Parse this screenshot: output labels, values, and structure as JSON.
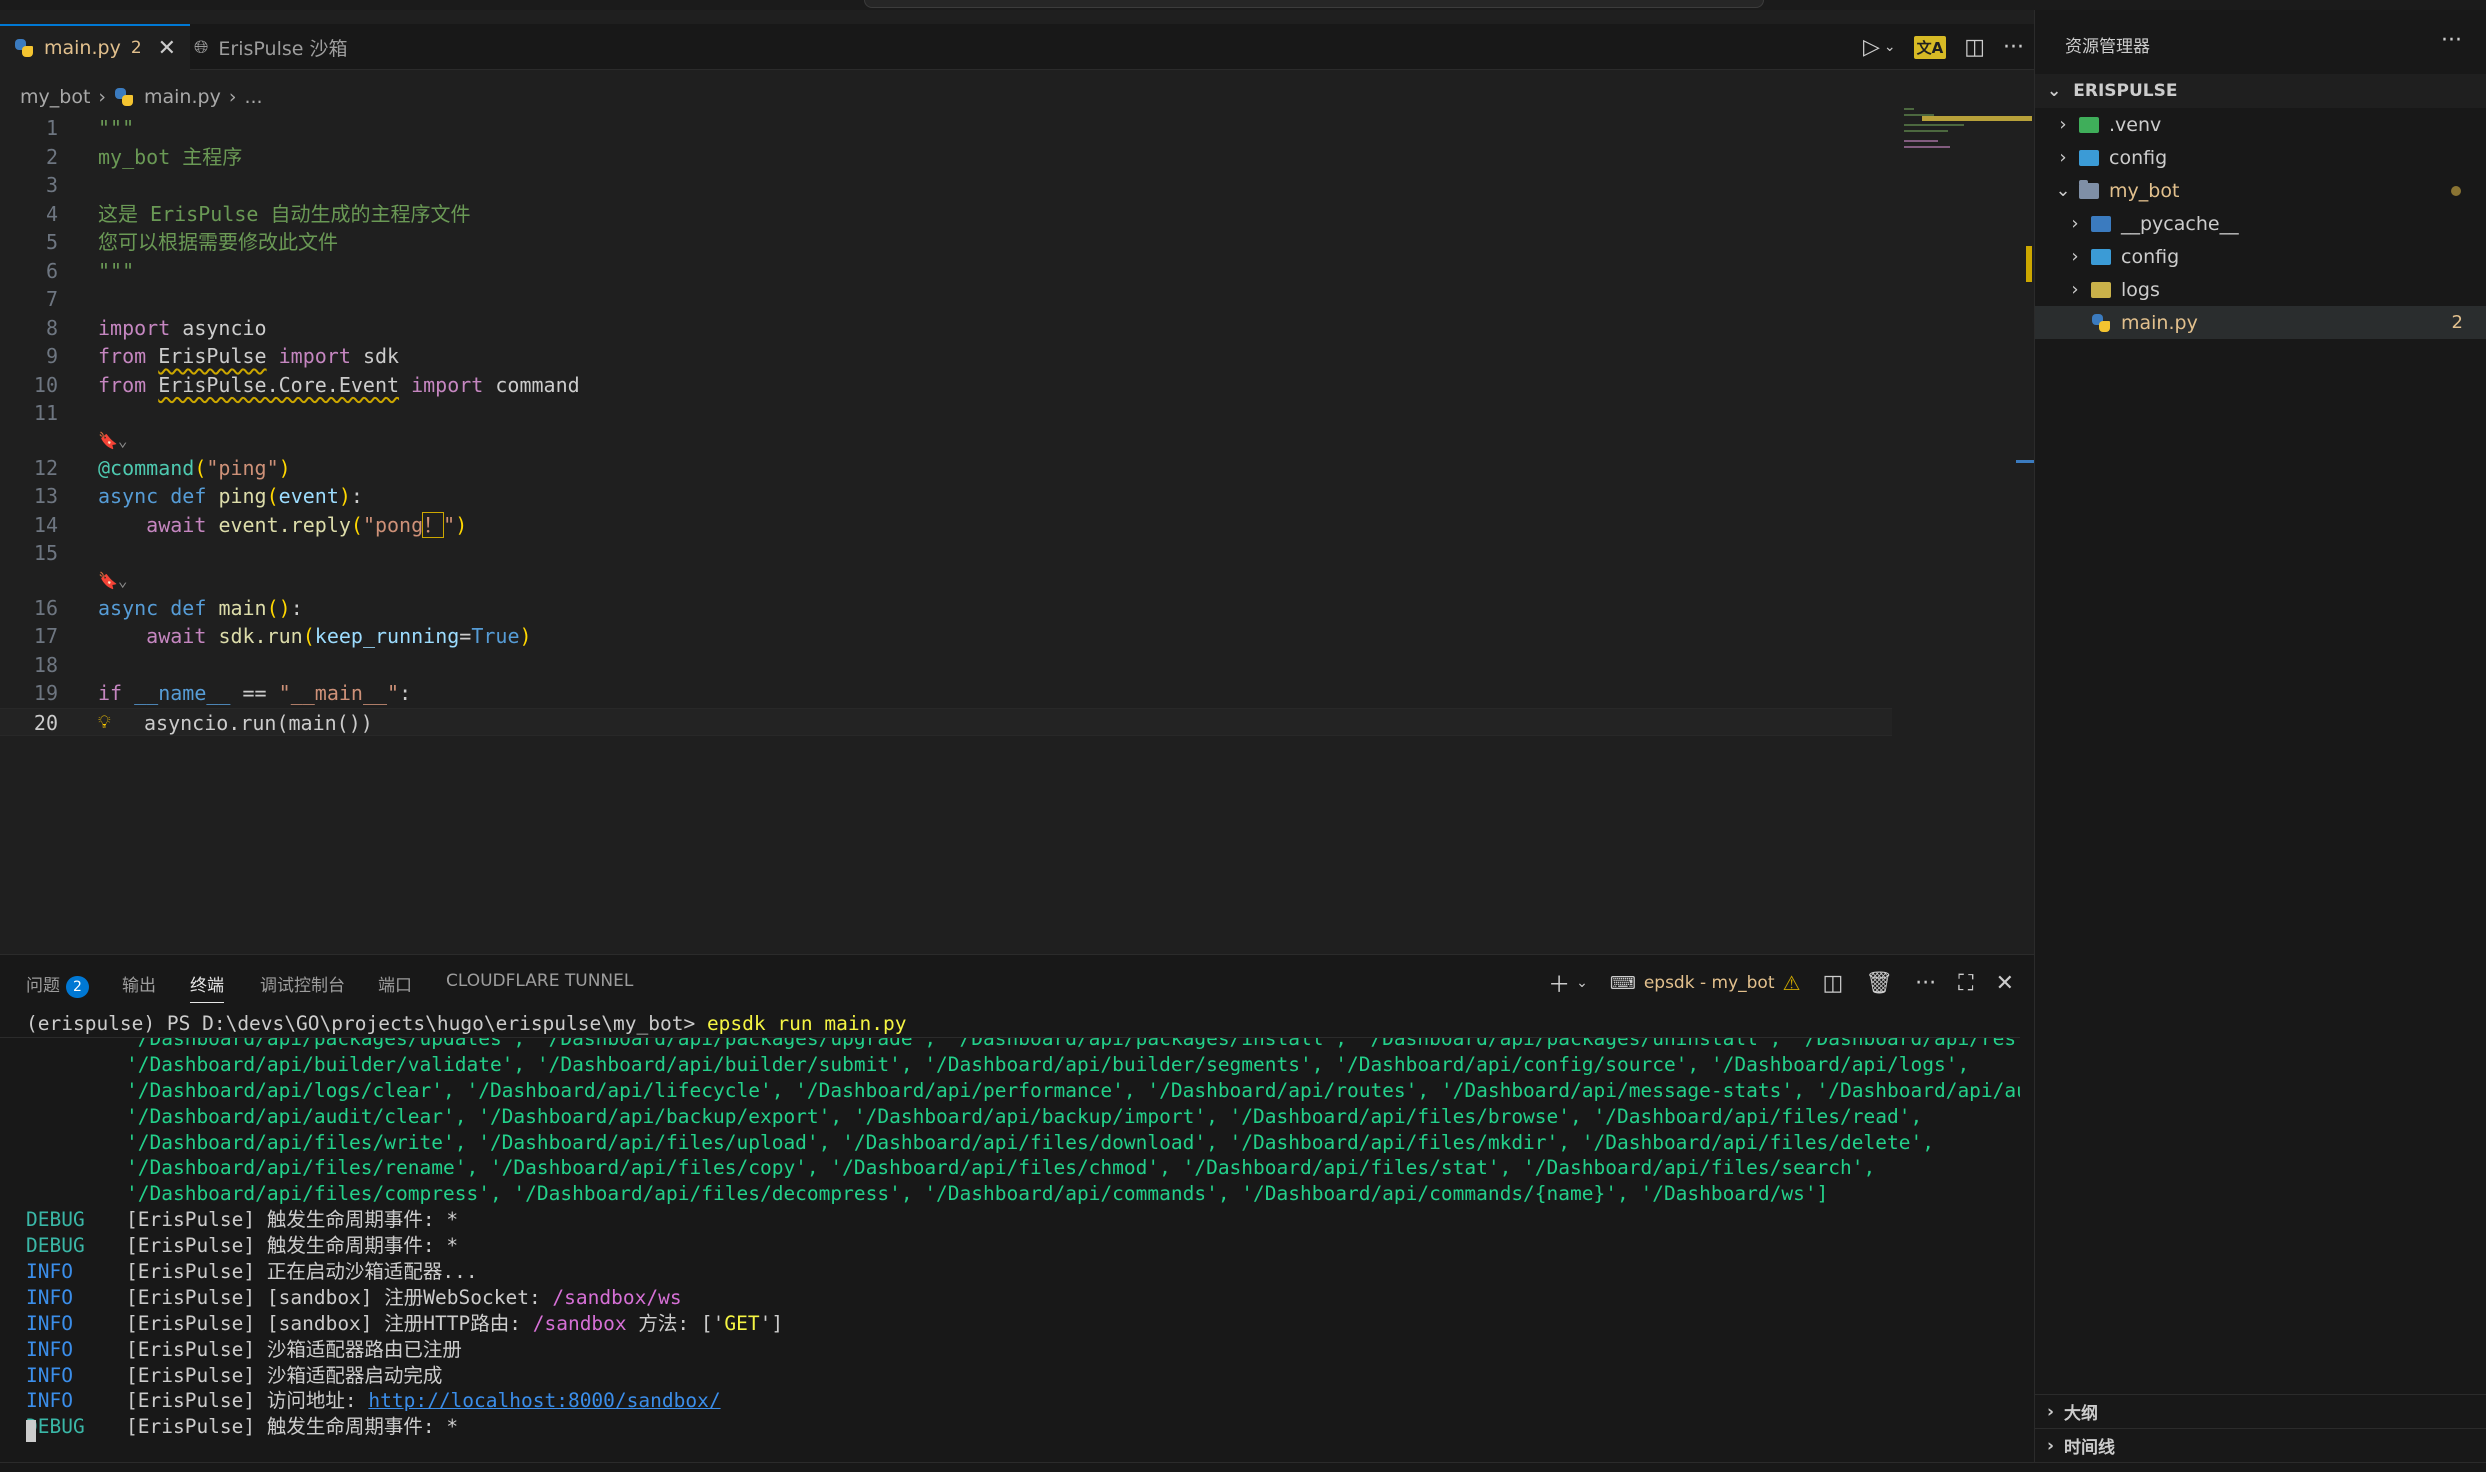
{
  "editor": {
    "tabs": [
      {
        "label": "main.py",
        "count": "2",
        "active": true
      },
      {
        "label": "ErisPulse 沙箱",
        "active": false
      }
    ],
    "breadcrumb": [
      "my_bot",
      "main.py",
      "..."
    ],
    "line_numbers": [
      "1",
      "2",
      "3",
      "4",
      "5",
      "6",
      "7",
      "8",
      "9",
      "10",
      "11",
      "12",
      "13",
      "14",
      "15",
      "16",
      "17",
      "18",
      "19",
      "20"
    ],
    "code": {
      "l1": "\"\"\"",
      "l2": "my_bot 主程序",
      "l4": "这是 ErisPulse 自动生成的主程序文件",
      "l5": "您可以根据需要修改此文件",
      "l6": "\"\"\"",
      "l8_kw": "import",
      "l8_mod": "asyncio",
      "l9_from": "from",
      "l9_mod": "ErisPulse",
      "l9_import": "import",
      "l9_name": "sdk",
      "l10_from": "from",
      "l10_mod": "ErisPulse.Core.Event",
      "l10_import": "import",
      "l10_name": "command",
      "lens": "🔖⌄",
      "l12_deco": "@command",
      "l12_arg": "\"ping\"",
      "l13_async": "async",
      "l13_def": "def",
      "l13_fn": "ping",
      "l13_param": "event",
      "l14_await": "await",
      "l14_call": "event.reply",
      "l14_str": "\"pong",
      "l14_bang": "！",
      "l14_q": "\"",
      "l16_async": "async",
      "l16_def": "def",
      "l16_fn": "main",
      "l17_await": "await",
      "l17_call": "sdk.run",
      "l17_kw": "keep_running",
      "l17_val": "True",
      "l19_if": "if",
      "l19_name": "__name__",
      "l19_op": "==",
      "l19_str": "\"__main__\"",
      "l20": "asyncio.run(main())"
    }
  },
  "panel": {
    "tabs": [
      {
        "label": "问题",
        "badge": "2"
      },
      {
        "label": "输出"
      },
      {
        "label": "终端",
        "active": true
      },
      {
        "label": "调试控制台"
      },
      {
        "label": "端口"
      },
      {
        "label": "CLOUDFLARE TUNNEL"
      }
    ],
    "terminal_name": "epsdk - my_bot",
    "prompt": "(erispulse) PS D:\\devs\\GO\\projects\\hugo\\erispulse\\my_bot>",
    "command": "epsdk run main.py",
    "path_lines": [
      "'/Dashboard/api/packages/updates', '/Dashboard/api/packages/upgrade', '/Dashboard/api/packages/install', '/Dashboard/api/packages/uninstall', '/Dashboard/api/restart',",
      "'/Dashboard/api/builder/validate', '/Dashboard/api/builder/submit', '/Dashboard/api/builder/segments', '/Dashboard/api/config/source', '/Dashboard/api/logs',",
      "'/Dashboard/api/logs/clear', '/Dashboard/api/lifecycle', '/Dashboard/api/performance', '/Dashboard/api/routes', '/Dashboard/api/message-stats', '/Dashboard/api/audit',",
      "'/Dashboard/api/audit/clear', '/Dashboard/api/backup/export', '/Dashboard/api/backup/import', '/Dashboard/api/files/browse', '/Dashboard/api/files/read',",
      "'/Dashboard/api/files/write', '/Dashboard/api/files/upload', '/Dashboard/api/files/download', '/Dashboard/api/files/mkdir', '/Dashboard/api/files/delete',",
      "'/Dashboard/api/files/rename', '/Dashboard/api/files/copy', '/Dashboard/api/files/chmod', '/Dashboard/api/files/stat', '/Dashboard/api/files/search',",
      "'/Dashboard/api/files/compress', '/Dashboard/api/files/decompress', '/Dashboard/api/commands', '/Dashboard/api/commands/{name}', '/Dashboard/ws']"
    ],
    "logs": [
      {
        "level": "DEBUG",
        "msg": "[ErisPulse] 触发生命周期事件: *"
      },
      {
        "level": "DEBUG",
        "msg": "[ErisPulse] 触发生命周期事件: *"
      },
      {
        "level": "INFO",
        "msg": "[ErisPulse] 正在启动沙箱适配器..."
      },
      {
        "level": "INFO",
        "msg": "[ErisPulse] [sandbox] 注册WebSocket: ",
        "route": "/sandbox/ws"
      },
      {
        "level": "INFO",
        "msg": "[ErisPulse] [sandbox] 注册HTTP路由: ",
        "route": "/sandbox",
        "after": " 方法: ['",
        "method": "GET",
        "end": "']"
      },
      {
        "level": "INFO",
        "msg": "[ErisPulse] 沙箱适配器路由已注册"
      },
      {
        "level": "INFO",
        "msg": "[ErisPulse] 沙箱适配器启动完成"
      },
      {
        "level": "INFO",
        "msg": "[ErisPulse] 访问地址: ",
        "link": "http://localhost:8000/sandbox/"
      },
      {
        "level": "DEBUG",
        "msg": "[ErisPulse] 触发生命周期事件: *"
      }
    ]
  },
  "explorer": {
    "title": "资源管理器",
    "root": "ERISPULSE",
    "items": [
      {
        "label": ".venv",
        "depth": 0,
        "color": "#3fae5a"
      },
      {
        "label": "config",
        "depth": 0,
        "color": "#3b9bd6"
      },
      {
        "label": "my_bot",
        "depth": 0,
        "color": "#7f8fa6"
      },
      {
        "label": "__pycache__",
        "depth": 1,
        "color": "#3b7bbf"
      },
      {
        "label": "config",
        "depth": 1,
        "color": "#3b9bd6"
      },
      {
        "label": "logs",
        "depth": 1,
        "color": "#c9b14a"
      },
      {
        "label": "main.py",
        "depth": 1,
        "count": "2"
      }
    ],
    "outline": "大纲",
    "timeline": "时间线"
  }
}
